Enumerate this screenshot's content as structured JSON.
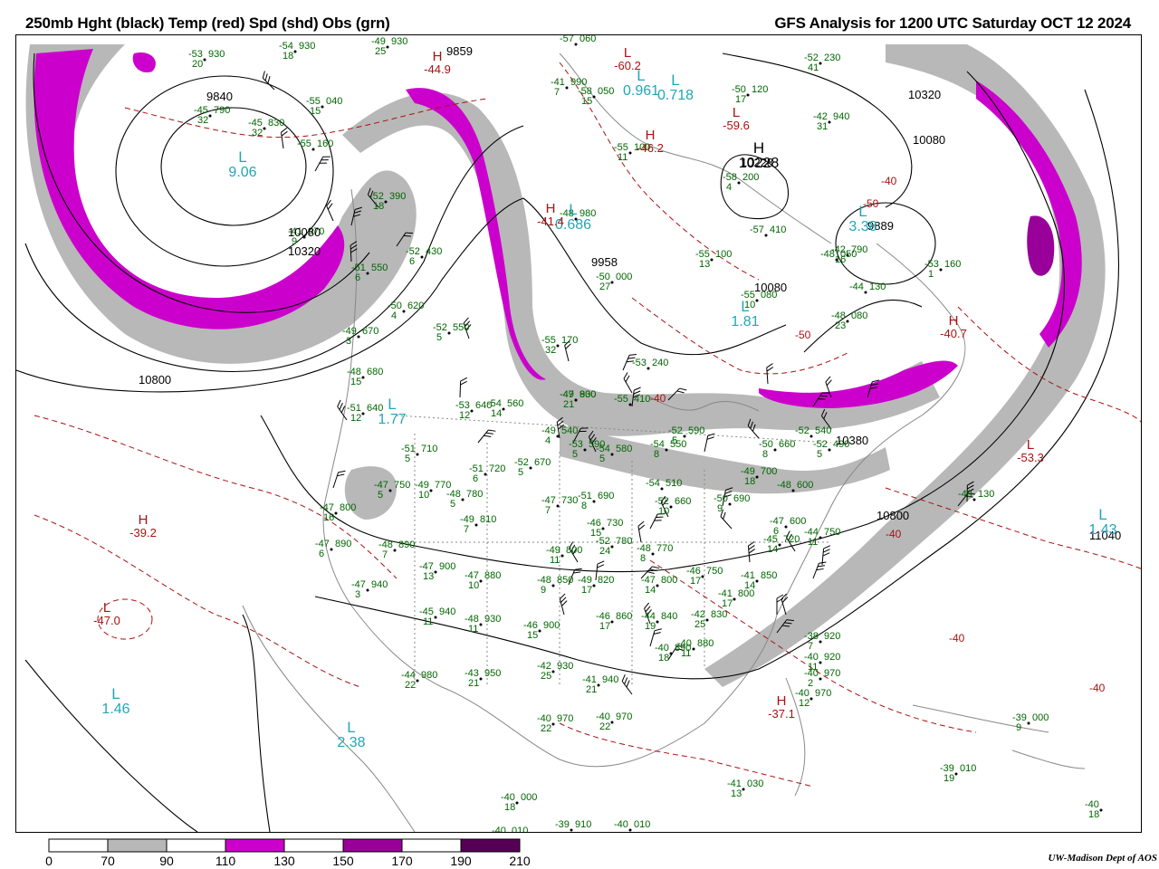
{
  "header": {
    "left_title": "250mb Hght (black) Temp (red) Spd (shd) Obs (grn)",
    "right_title": "GFS Analysis for 1200 UTC Saturday  OCT 12 2024"
  },
  "credit": "UW-Madison  Dept of AOS",
  "colors": {
    "height": "#000000",
    "temperature": "#aa1111",
    "speed_70_90": "#b8b8b8",
    "speed_110_130": "#cc00cc",
    "speed_150_170": "#990099",
    "speed_190_210": "#550055",
    "observations": "#006600",
    "minima_labels": "#22a6b8",
    "map_outline": "#888888"
  },
  "legend": {
    "ticks": [
      "0",
      "70",
      "90",
      "110",
      "130",
      "150",
      "170",
      "190",
      "210"
    ],
    "bins": [
      {
        "from": "0",
        "to": "70",
        "color": "#ffffff"
      },
      {
        "from": "70",
        "to": "90",
        "color": "#b8b8b8"
      },
      {
        "from": "90",
        "to": "110",
        "color": "#ffffff"
      },
      {
        "from": "110",
        "to": "130",
        "color": "#cc00cc"
      },
      {
        "from": "130",
        "to": "150",
        "color": "#ffffff"
      },
      {
        "from": "150",
        "to": "170",
        "color": "#990099"
      },
      {
        "from": "170",
        "to": "190",
        "color": "#ffffff"
      },
      {
        "from": "190",
        "to": "210",
        "color": "#550055"
      }
    ]
  },
  "height_labels": [
    "9840",
    "9859",
    "10080",
    "10320",
    "10800",
    "10320",
    "10080",
    "10228",
    "9958",
    "10080",
    "9889",
    "10380",
    "10800",
    "11040"
  ],
  "pressure_centers": [
    {
      "letter": "L",
      "kind": "low",
      "value": "9.06"
    },
    {
      "letter": "H",
      "kind": "high",
      "value": "10228"
    },
    {
      "letter": "L",
      "kind": "low",
      "value": "0.961"
    },
    {
      "letter": "L",
      "kind": "low",
      "value": "0.718"
    },
    {
      "letter": "L",
      "kind": "low",
      "value": "0.686"
    },
    {
      "letter": "L",
      "kind": "low",
      "value": "1.81"
    },
    {
      "letter": "L",
      "kind": "low",
      "value": "1.77"
    },
    {
      "letter": "L",
      "kind": "low",
      "value": "1.46"
    },
    {
      "letter": "L",
      "kind": "low",
      "value": "2.38"
    },
    {
      "letter": "L",
      "kind": "low",
      "value": "1.43"
    },
    {
      "letter": "L",
      "kind": "low",
      "value": "3.38"
    }
  ],
  "temp_extrema": [
    {
      "letter": "H",
      "value": "-44.9"
    },
    {
      "letter": "L",
      "value": "-60.2"
    },
    {
      "letter": "L",
      "value": "-59.6"
    },
    {
      "letter": "H",
      "value": "-46.2"
    },
    {
      "letter": "H",
      "value": "-41.4"
    },
    {
      "letter": "L",
      "value": "-47.0"
    },
    {
      "letter": "H",
      "value": "-39.2"
    },
    {
      "letter": "H",
      "value": "-37.1"
    },
    {
      "letter": "L",
      "value": "-53.3"
    },
    {
      "letter": "H",
      "value": "-40.7"
    }
  ],
  "temp_labels": [
    "-40",
    "-50",
    "-40",
    "-40",
    "-40",
    "-50",
    "-40"
  ],
  "observations": [
    {
      "temp": "-53",
      "value": "930",
      "dewpt": "20"
    },
    {
      "temp": "-54",
      "value": "930",
      "dewpt": "18"
    },
    {
      "temp": "-49",
      "value": "930",
      "dewpt": "25"
    },
    {
      "temp": "-55",
      "value": "040",
      "dewpt": "15"
    },
    {
      "temp": "-45",
      "value": "790",
      "dewpt": "32"
    },
    {
      "temp": "-45",
      "value": "830",
      "dewpt": "32"
    },
    {
      "temp": "-52",
      "value": "390",
      "dewpt": "18"
    },
    {
      "temp": "-51",
      "value": "550",
      "dewpt": "6"
    },
    {
      "temp": "-52",
      "value": "430",
      "dewpt": "6"
    },
    {
      "temp": "-50",
      "value": "620",
      "dewpt": "4"
    },
    {
      "temp": "-52",
      "value": "550",
      "dewpt": "5"
    },
    {
      "temp": "-49",
      "value": "670",
      "dewpt": "3"
    },
    {
      "temp": "-48",
      "value": "680",
      "dewpt": "15"
    },
    {
      "temp": "-51",
      "value": "640",
      "dewpt": "12"
    },
    {
      "temp": "-53",
      "value": "640",
      "dewpt": "12"
    },
    {
      "temp": "-54",
      "value": "560",
      "dewpt": "14"
    },
    {
      "temp": "-51",
      "value": "710",
      "dewpt": "5"
    },
    {
      "temp": "-51",
      "value": "720",
      "dewpt": "6"
    },
    {
      "temp": "-52",
      "value": "670",
      "dewpt": "5"
    },
    {
      "temp": "-47",
      "value": "750",
      "dewpt": "5"
    },
    {
      "temp": "-49",
      "value": "770",
      "dewpt": "10"
    },
    {
      "temp": "-48",
      "value": "780",
      "dewpt": "5"
    },
    {
      "temp": "-47",
      "value": "800",
      "dewpt": "16"
    },
    {
      "temp": "-49",
      "value": "810",
      "dewpt": "7"
    },
    {
      "temp": "-47",
      "value": "730",
      "dewpt": "7"
    },
    {
      "temp": "-51",
      "value": "690",
      "dewpt": "8"
    },
    {
      "temp": "-47",
      "value": "890",
      "dewpt": "6"
    },
    {
      "temp": "-48",
      "value": "890",
      "dewpt": "7"
    },
    {
      "temp": "-47",
      "value": "900",
      "dewpt": "13"
    },
    {
      "temp": "-49",
      "value": "800",
      "dewpt": "11"
    },
    {
      "temp": "-48",
      "value": "770",
      "dewpt": "8"
    },
    {
      "temp": "-46",
      "value": "730",
      "dewpt": "15"
    },
    {
      "temp": "-47",
      "value": "940",
      "dewpt": "3"
    },
    {
      "temp": "-47",
      "value": "880",
      "dewpt": "10"
    },
    {
      "temp": "-48",
      "value": "850",
      "dewpt": "9"
    },
    {
      "temp": "-49",
      "value": "820",
      "dewpt": "17"
    },
    {
      "temp": "-47",
      "value": "800",
      "dewpt": "14"
    },
    {
      "temp": "-46",
      "value": "750",
      "dewpt": "17"
    },
    {
      "temp": "-45",
      "value": "940",
      "dewpt": "11"
    },
    {
      "temp": "-48",
      "value": "930",
      "dewpt": "11"
    },
    {
      "temp": "-46",
      "value": "900",
      "dewpt": "15"
    },
    {
      "temp": "-46",
      "value": "860",
      "dewpt": "17"
    },
    {
      "temp": "-44",
      "value": "840",
      "dewpt": "19"
    },
    {
      "temp": "-42",
      "value": "830",
      "dewpt": "25"
    },
    {
      "temp": "-41",
      "value": "850",
      "dewpt": "14"
    },
    {
      "temp": "-41",
      "value": "800",
      "dewpt": "17"
    },
    {
      "temp": "-44",
      "value": "980",
      "dewpt": "22"
    },
    {
      "temp": "-43",
      "value": "950",
      "dewpt": "21"
    },
    {
      "temp": "-42",
      "value": "930",
      "dewpt": "25"
    },
    {
      "temp": "-41",
      "value": "940",
      "dewpt": "21"
    },
    {
      "temp": "-40",
      "value": "890",
      "dewpt": "18"
    },
    {
      "temp": "-40",
      "value": "880",
      "dewpt": "11"
    },
    {
      "temp": "-40",
      "value": "970",
      "dewpt": "22"
    },
    {
      "temp": "-40",
      "value": "970",
      "dewpt": "22"
    },
    {
      "temp": "-40",
      "value": "000",
      "dewpt": "18"
    },
    {
      "temp": "-39",
      "value": "910",
      "dewpt": ""
    },
    {
      "temp": "-40",
      "value": "010",
      "dewpt": ""
    },
    {
      "temp": "-41",
      "value": "030",
      "dewpt": "13"
    },
    {
      "temp": "-40",
      "value": "010",
      "dewpt": ""
    },
    {
      "temp": "-48",
      "value": "980",
      "dewpt": ""
    },
    {
      "temp": "-50",
      "value": "000",
      "dewpt": "27"
    },
    {
      "temp": "-55",
      "value": "100",
      "dewpt": "13"
    },
    {
      "temp": "-55",
      "value": "080",
      "dewpt": "10"
    },
    {
      "temp": "-57",
      "value": "410",
      "dewpt": ""
    },
    {
      "temp": "-58",
      "value": "200",
      "dewpt": "4"
    },
    {
      "temp": "-55",
      "value": "100",
      "dewpt": "11"
    },
    {
      "temp": "-58",
      "value": "050",
      "dewpt": "15"
    },
    {
      "temp": "-57",
      "value": "060",
      "dewpt": ""
    },
    {
      "temp": "-55",
      "value": "170",
      "dewpt": "32"
    },
    {
      "temp": "-53",
      "value": "240",
      "dewpt": ""
    },
    {
      "temp": "-55",
      "value": "410",
      "dewpt": ""
    },
    {
      "temp": "-49",
      "value": "540",
      "dewpt": "4"
    },
    {
      "temp": "-53",
      "value": "590",
      "dewpt": "5"
    },
    {
      "temp": "-54",
      "value": "580",
      "dewpt": "5"
    },
    {
      "temp": "-54",
      "value": "550",
      "dewpt": "8"
    },
    {
      "temp": "-52",
      "value": "590",
      "dewpt": "5"
    },
    {
      "temp": "-54",
      "value": "510",
      "dewpt": ""
    },
    {
      "temp": "-52",
      "value": "660",
      "dewpt": "10"
    },
    {
      "temp": "-50",
      "value": "690",
      "dewpt": "9"
    },
    {
      "temp": "-49",
      "value": "700",
      "dewpt": "18"
    },
    {
      "temp": "-50",
      "value": "660",
      "dewpt": "8"
    },
    {
      "temp": "-52",
      "value": "540",
      "dewpt": ""
    },
    {
      "temp": "-52",
      "value": "490",
      "dewpt": "5"
    },
    {
      "temp": "-48",
      "value": "600",
      "dewpt": ""
    },
    {
      "temp": "-47",
      "value": "600",
      "dewpt": "6"
    },
    {
      "temp": "-45",
      "value": "720",
      "dewpt": "14"
    },
    {
      "temp": "-44",
      "value": "750",
      "dewpt": "11"
    },
    {
      "temp": "-42",
      "value": "790",
      "dewpt": "16"
    },
    {
      "temp": "-44",
      "value": "130",
      "dewpt": ""
    },
    {
      "temp": "-48",
      "value": "080",
      "dewpt": "23"
    },
    {
      "temp": "-48",
      "value": "050",
      "dewpt": ""
    },
    {
      "temp": "-42",
      "value": "940",
      "dewpt": "31"
    },
    {
      "temp": "-52",
      "value": "230",
      "dewpt": "41"
    },
    {
      "temp": "-50",
      "value": "120",
      "dewpt": "17"
    },
    {
      "temp": "-53",
      "value": "160",
      "dewpt": "1"
    },
    {
      "temp": "-49",
      "value": "130",
      "dewpt": ""
    },
    {
      "temp": "-38",
      "value": "920",
      "dewpt": "7"
    },
    {
      "temp": "-40",
      "value": "920",
      "dewpt": "11"
    },
    {
      "temp": "-40",
      "value": "970",
      "dewpt": "2"
    },
    {
      "temp": "-40",
      "value": "970",
      "dewpt": "12"
    },
    {
      "temp": "-39",
      "value": "000",
      "dewpt": "9"
    },
    {
      "temp": "-39",
      "value": "010",
      "dewpt": "19"
    },
    {
      "temp": "-40",
      "value": "",
      "dewpt": "18"
    },
    {
      "temp": "-41",
      "value": "990",
      "dewpt": "7"
    },
    {
      "temp": "-41",
      "value": "970",
      "dewpt": "9"
    },
    {
      "temp": "-55",
      "value": "160",
      "dewpt": ""
    },
    {
      "temp": "-52",
      "value": "780",
      "dewpt": "24"
    },
    {
      "temp": "-47",
      "value": "800",
      "dewpt": "21"
    },
    {
      "temp": "-49",
      "value": "930",
      "dewpt": ""
    }
  ]
}
